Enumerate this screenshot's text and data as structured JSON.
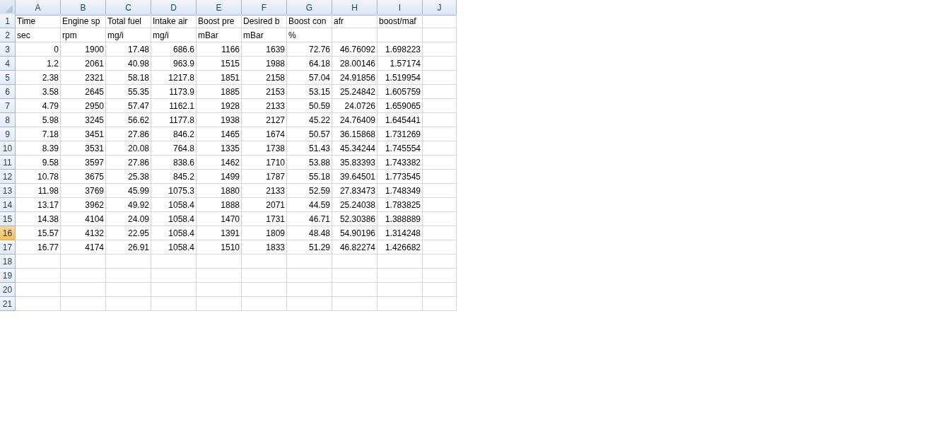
{
  "columns": [
    "A",
    "B",
    "C",
    "D",
    "E",
    "F",
    "G",
    "H",
    "I",
    "J"
  ],
  "rows": [
    {
      "number": "1",
      "selected": false,
      "kind": "text",
      "cells": [
        "Time",
        "Engine sp",
        "Total fuel",
        "Intake air",
        "Boost pre",
        "Desired b",
        "Boost con",
        "afr",
        "boost/maf"
      ]
    },
    {
      "number": "2",
      "selected": false,
      "kind": "text",
      "cells": [
        "sec",
        "rpm",
        "mg/i",
        "mg/i",
        "mBar",
        "mBar",
        "%"
      ]
    },
    {
      "number": "3",
      "selected": false,
      "kind": "number",
      "cells": [
        "0",
        "1900",
        "17.48",
        "686.6",
        "1166",
        "1639",
        "72.76",
        "46.76092",
        "1.698223"
      ]
    },
    {
      "number": "4",
      "selected": false,
      "kind": "number",
      "cells": [
        "1.2",
        "2061",
        "40.98",
        "963.9",
        "1515",
        "1988",
        "64.18",
        "28.00146",
        "1.57174"
      ]
    },
    {
      "number": "5",
      "selected": false,
      "kind": "number",
      "cells": [
        "2.38",
        "2321",
        "58.18",
        "1217.8",
        "1851",
        "2158",
        "57.04",
        "24.91856",
        "1.519954"
      ]
    },
    {
      "number": "6",
      "selected": false,
      "kind": "number",
      "cells": [
        "3.58",
        "2645",
        "55.35",
        "1173.9",
        "1885",
        "2153",
        "53.15",
        "25.24842",
        "1.605759"
      ]
    },
    {
      "number": "7",
      "selected": false,
      "kind": "number",
      "cells": [
        "4.79",
        "2950",
        "57.47",
        "1162.1",
        "1928",
        "2133",
        "50.59",
        "24.0726",
        "1.659065"
      ]
    },
    {
      "number": "8",
      "selected": false,
      "kind": "number",
      "cells": [
        "5.98",
        "3245",
        "56.62",
        "1177.8",
        "1938",
        "2127",
        "45.22",
        "24.76409",
        "1.645441"
      ]
    },
    {
      "number": "9",
      "selected": false,
      "kind": "number",
      "cells": [
        "7.18",
        "3451",
        "27.86",
        "846.2",
        "1465",
        "1674",
        "50.57",
        "36.15868",
        "1.731269"
      ]
    },
    {
      "number": "10",
      "selected": false,
      "kind": "number",
      "cells": [
        "8.39",
        "3531",
        "20.08",
        "764.8",
        "1335",
        "1738",
        "51.43",
        "45.34244",
        "1.745554"
      ]
    },
    {
      "number": "11",
      "selected": false,
      "kind": "number",
      "cells": [
        "9.58",
        "3597",
        "27.86",
        "838.6",
        "1462",
        "1710",
        "53.88",
        "35.83393",
        "1.743382"
      ]
    },
    {
      "number": "12",
      "selected": false,
      "kind": "number",
      "cells": [
        "10.78",
        "3675",
        "25.38",
        "845.2",
        "1499",
        "1787",
        "55.18",
        "39.64501",
        "1.773545"
      ]
    },
    {
      "number": "13",
      "selected": false,
      "kind": "number",
      "cells": [
        "11.98",
        "3769",
        "45.99",
        "1075.3",
        "1880",
        "2133",
        "52.59",
        "27.83473",
        "1.748349"
      ]
    },
    {
      "number": "14",
      "selected": false,
      "kind": "number",
      "cells": [
        "13.17",
        "3962",
        "49.92",
        "1058.4",
        "1888",
        "2071",
        "44.59",
        "25.24038",
        "1.783825"
      ]
    },
    {
      "number": "15",
      "selected": false,
      "kind": "number",
      "cells": [
        "14.38",
        "4104",
        "24.09",
        "1058.4",
        "1470",
        "1731",
        "46.71",
        "52.30386",
        "1.388889"
      ]
    },
    {
      "number": "16",
      "selected": true,
      "kind": "number",
      "cells": [
        "15.57",
        "4132",
        "22.95",
        "1058.4",
        "1391",
        "1809",
        "48.48",
        "54.90196",
        "1.314248"
      ]
    },
    {
      "number": "17",
      "selected": false,
      "kind": "number",
      "cells": [
        "16.77",
        "4174",
        "26.91",
        "1058.4",
        "1510",
        "1833",
        "51.29",
        "46.82274",
        "1.426682"
      ]
    },
    {
      "number": "18",
      "selected": false
    },
    {
      "number": "19",
      "selected": false
    },
    {
      "number": "20",
      "selected": false
    },
    {
      "number": "21",
      "selected": false
    }
  ]
}
